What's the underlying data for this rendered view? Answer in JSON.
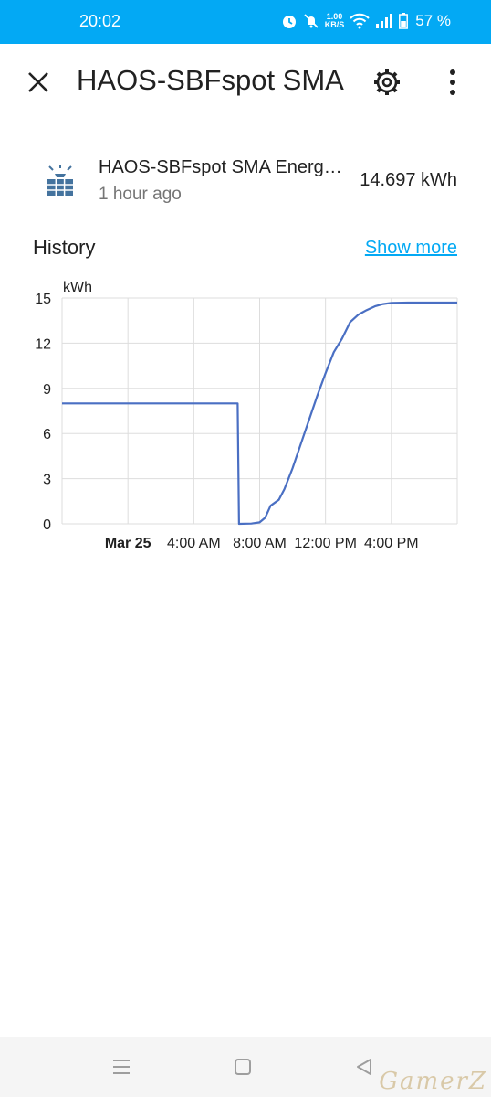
{
  "status_bar": {
    "time": "20:02",
    "net_speed_value": "1.00",
    "net_speed_unit": "KB/S",
    "battery_percent": "57 %",
    "icons": [
      "alarm-icon",
      "mute-icon",
      "wifi-icon",
      "signal-icon",
      "battery-icon"
    ]
  },
  "header": {
    "title": "HAOS-SBFspot SMA",
    "close_icon": "close-icon",
    "settings_icon": "gear-icon",
    "more_icon": "more-vertical-icon"
  },
  "entity": {
    "icon": "solar-panel-icon",
    "name": "HAOS-SBFspot SMA Energy Today",
    "last_updated": "1 hour ago",
    "state": "14.697 kWh"
  },
  "history": {
    "title": "History",
    "show_more": "Show more"
  },
  "colors": {
    "accent": "#03a9f4",
    "series": "#4a6fc3",
    "grid": "#dddddd"
  },
  "chart_data": {
    "type": "line",
    "ylabel": "kWh",
    "ylim": [
      0,
      15
    ],
    "yticks": [
      0,
      3,
      6,
      9,
      12,
      15
    ],
    "x_range": [
      "Mar 24 20:00",
      "Mar 25 20:00"
    ],
    "xticks": [
      {
        "value": "Mar 25 00:00",
        "label": "Mar 25",
        "bold": true
      },
      {
        "value": "Mar 25 04:00",
        "label": "4:00 AM",
        "bold": false
      },
      {
        "value": "Mar 25 08:00",
        "label": "8:00 AM",
        "bold": false
      },
      {
        "value": "Mar 25 12:00",
        "label": "12:00 PM",
        "bold": false
      },
      {
        "value": "Mar 25 16:00",
        "label": "4:00 PM",
        "bold": false
      }
    ],
    "grid": true,
    "series": [
      {
        "values": [
          [
            "Mar 24 20:00",
            8.0
          ],
          [
            "Mar 25 06:40",
            8.0
          ],
          [
            "Mar 25 06:45",
            0.0
          ],
          [
            "Mar 25 07:30",
            0.02
          ],
          [
            "Mar 25 08:00",
            0.1
          ],
          [
            "Mar 25 08:20",
            0.4
          ],
          [
            "Mar 25 08:40",
            1.2
          ],
          [
            "Mar 25 09:10",
            1.6
          ],
          [
            "Mar 25 09:30",
            2.3
          ],
          [
            "Mar 25 10:00",
            3.7
          ],
          [
            "Mar 25 10:30",
            5.3
          ],
          [
            "Mar 25 11:00",
            6.9
          ],
          [
            "Mar 25 11:30",
            8.5
          ],
          [
            "Mar 25 12:00",
            10.0
          ],
          [
            "Mar 25 12:30",
            11.4
          ],
          [
            "Mar 25 13:00",
            12.3
          ],
          [
            "Mar 25 13:30",
            13.4
          ],
          [
            "Mar 25 14:00",
            13.9
          ],
          [
            "Mar 25 14:30",
            14.2
          ],
          [
            "Mar 25 15:00",
            14.45
          ],
          [
            "Mar 25 15:30",
            14.6
          ],
          [
            "Mar 25 16:00",
            14.68
          ],
          [
            "Mar 25 17:00",
            14.697
          ],
          [
            "Mar 25 20:00",
            14.697
          ]
        ]
      }
    ]
  }
}
